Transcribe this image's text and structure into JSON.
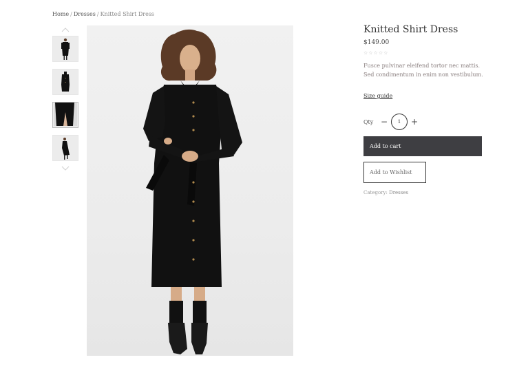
{
  "breadcrumb": {
    "home": "Home",
    "separator": "/",
    "category": "Dresses",
    "current": "Knitted Shirt Dress"
  },
  "gallery": {
    "thumbnail_count": 4,
    "active_thumbnail": 3,
    "up_icon": "chevron-up-icon",
    "down_icon": "chevron-down-icon"
  },
  "product": {
    "title": "Knitted Shirt Dress",
    "price": "$149.00",
    "rating_stars": "☆☆☆☆☆",
    "description": "Fusce pulvinar eleifend tortor nec mattis. Sed condimentum in enim non vestibulum.",
    "size_guide_label": "Size guide",
    "qty_label": "Qty",
    "qty_minus": "−",
    "qty_value": "1",
    "qty_plus": "+",
    "add_to_cart_label": "Add to cart",
    "wishlist_label": "Add to Wishlist",
    "category_label": "Category:",
    "category_value": "Dresses"
  },
  "colors": {
    "button_dark": "#3e3e42",
    "image_bg": "#ececec",
    "dress": "#111111"
  }
}
